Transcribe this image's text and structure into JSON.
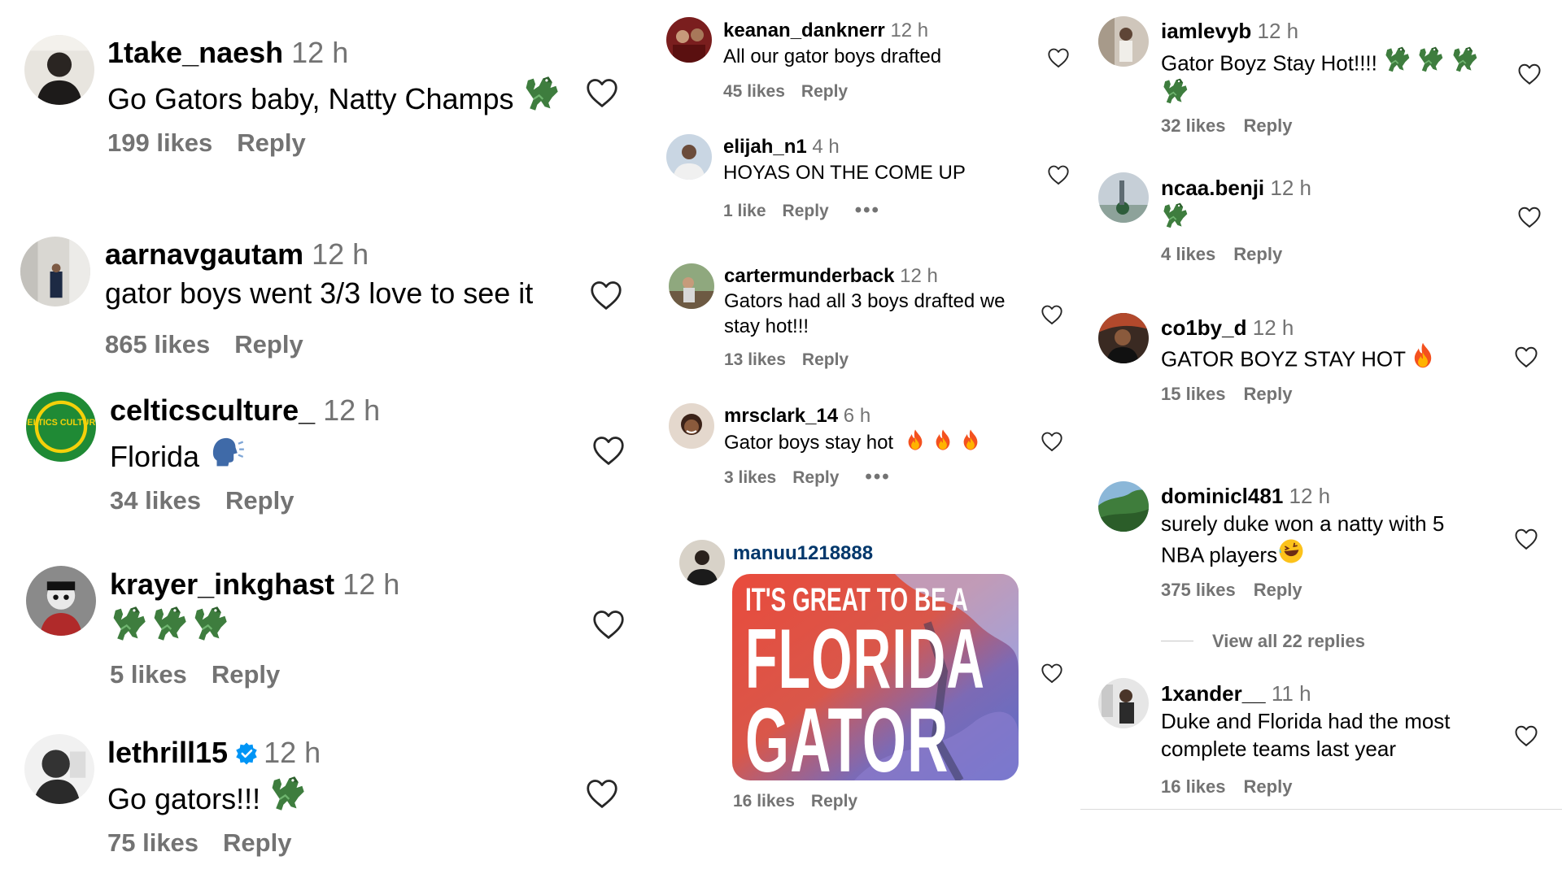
{
  "column1": [
    {
      "username": "1take_naesh",
      "time": "12 h",
      "text": "Go Gators baby, Natty Champs",
      "likes": "199 likes",
      "reply": "Reply",
      "emoji": [
        "alligator-emoji"
      ]
    },
    {
      "username": "aarnavgautam",
      "time": "12 h",
      "text": "gator boys went 3/3 love to see it",
      "likes": "865 likes",
      "reply": "Reply"
    },
    {
      "username": "celticsculture_",
      "time": "12 h",
      "text": "Florida",
      "likes": "34 likes",
      "reply": "Reply",
      "emoji": [
        "speaking-head-emoji"
      ],
      "avatar_text": "CELTICS CULTURE"
    },
    {
      "username": "krayer_inkghast",
      "time": "12 h",
      "text": "",
      "likes": "5 likes",
      "reply": "Reply",
      "emoji": [
        "alligator-emoji",
        "alligator-emoji",
        "alligator-emoji"
      ]
    },
    {
      "username": "lethrill15",
      "time": "12 h",
      "text": "Go gators!!!",
      "likes": "75 likes",
      "reply": "Reply",
      "verified": true,
      "emoji": [
        "alligator-emoji"
      ]
    }
  ],
  "column2": [
    {
      "username": "keanan_danknerr",
      "time": "12 h",
      "text": "All our gator boys drafted",
      "likes": "45 likes",
      "reply": "Reply"
    },
    {
      "username": "elijah_n1",
      "time": "4 h",
      "text": "HOYAS ON THE COME UP",
      "likes": "1 like",
      "reply": "Reply",
      "more": "•••"
    },
    {
      "username": "cartermunderback",
      "time": "12 h",
      "text": "Gators had all 3 boys drafted we",
      "text2": "stay hot!!!",
      "likes": "13 likes",
      "reply": "Reply"
    },
    {
      "username": "mrsclark_14",
      "time": "6 h",
      "text": "Gator boys stay hot",
      "likes": "3 likes",
      "reply": "Reply",
      "more": "•••",
      "emoji": [
        "fire-emoji",
        "fire-emoji",
        "fire-emoji"
      ]
    },
    {
      "username": "manuu1218888",
      "likes": "16 likes",
      "reply": "Reply",
      "image": {
        "line1": "IT'S GREAT TO BE A",
        "line2": "FLORIDA",
        "line3": "GATOR"
      }
    }
  ],
  "column3": [
    {
      "username": "iamlevyb",
      "time": "12 h",
      "text": "Gator Boyz Stay Hot!!!!",
      "likes": "32 likes",
      "reply": "Reply",
      "emoji": [
        "alligator-emoji",
        "alligator-emoji",
        "alligator-emoji",
        "alligator-emoji"
      ]
    },
    {
      "username": "ncaa.benji",
      "time": "12 h",
      "text": "",
      "likes": "4 likes",
      "reply": "Reply",
      "emoji": [
        "alligator-emoji"
      ]
    },
    {
      "username": "co1by_d",
      "time": "12 h",
      "text": "GATOR BOYZ STAY HOT",
      "likes": "15 likes",
      "reply": "Reply",
      "emoji": [
        "fire-emoji"
      ]
    },
    {
      "username": "dominicl481",
      "time": "12 h",
      "text": "surely duke won a natty with 5",
      "text2": "NBA players",
      "likes": "375 likes",
      "reply": "Reply",
      "emoji": [
        "rofl-emoji"
      ]
    },
    {
      "username": "1xander__",
      "time": "11 h",
      "text": "Duke and Florida had the most",
      "text2": "complete teams last year",
      "likes": "16 likes",
      "reply": "Reply"
    }
  ],
  "view_replies": "View all 22 replies",
  "colors": {
    "username": "#000000",
    "secondary": "#737373",
    "link": "#00376b",
    "verified": "#0095f6"
  }
}
